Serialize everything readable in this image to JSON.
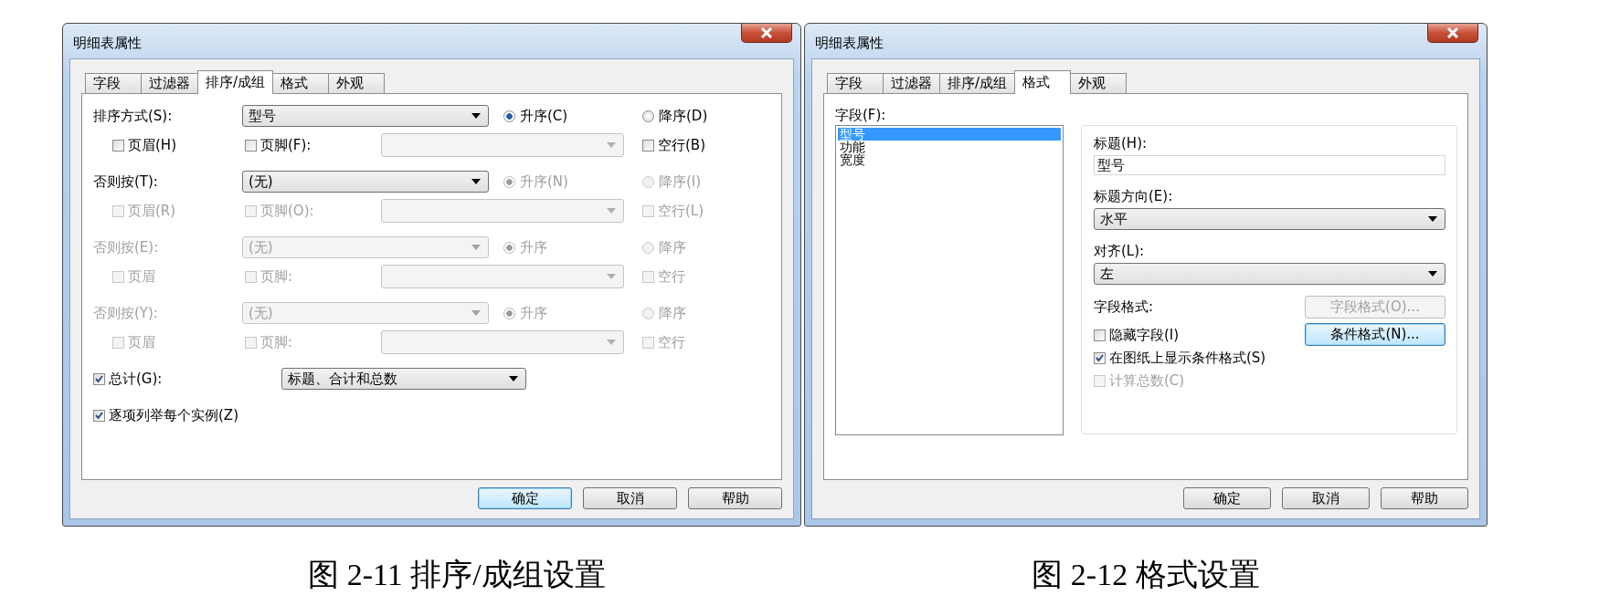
{
  "figures": [
    {
      "dialog": {
        "title": "明细表属性",
        "tabs": [
          {
            "label": "字段",
            "selected": false
          },
          {
            "label": "过滤器",
            "selected": false
          },
          {
            "label": "排序/成组",
            "selected": true
          },
          {
            "label": "格式",
            "selected": false
          },
          {
            "label": "外观",
            "selected": false
          }
        ],
        "kind": "sorting",
        "sort_groups": [
          {
            "label": "排序方式(S):",
            "disabled": false,
            "combo": {
              "value": "型号",
              "disabled": false
            },
            "ascending": {
              "label": "升序(C)",
              "selected": true,
              "disabled": false
            },
            "descending": {
              "label": "降序(D)",
              "selected": false,
              "disabled": false
            },
            "header": {
              "label": "页眉(H)",
              "checked": false,
              "disabled": false
            },
            "footer": {
              "label": "页脚(F):",
              "checked": false,
              "disabled": false
            },
            "footer_combo": {
              "disabled": true
            },
            "blank_line": {
              "label": "空行(B)",
              "checked": false,
              "disabled": false
            }
          },
          {
            "label": "否则按(T):",
            "disabled": false,
            "combo": {
              "value": "(无)",
              "disabled": false
            },
            "ascending": {
              "label": "升序(N)",
              "selected": true,
              "disabled": true
            },
            "descending": {
              "label": "降序(I)",
              "selected": false,
              "disabled": true
            },
            "header": {
              "label": "页眉(R)",
              "checked": false,
              "disabled": true
            },
            "footer": {
              "label": "页脚(O):",
              "checked": false,
              "disabled": true
            },
            "footer_combo": {
              "disabled": true
            },
            "blank_line": {
              "label": "空行(L)",
              "checked": false,
              "disabled": true
            }
          },
          {
            "label": "否则按(E):",
            "disabled": true,
            "combo": {
              "value": "(无)",
              "disabled": true
            },
            "ascending": {
              "label": "升序",
              "selected": true,
              "disabled": true
            },
            "descending": {
              "label": "降序",
              "selected": false,
              "disabled": true
            },
            "header": {
              "label": "页眉",
              "checked": false,
              "disabled": true
            },
            "footer": {
              "label": "页脚:",
              "checked": false,
              "disabled": true
            },
            "footer_combo": {
              "disabled": true
            },
            "blank_line": {
              "label": "空行",
              "checked": false,
              "disabled": true
            }
          },
          {
            "label": "否则按(Y):",
            "disabled": true,
            "combo": {
              "value": "(无)",
              "disabled": true
            },
            "ascending": {
              "label": "升序",
              "selected": true,
              "disabled": true
            },
            "descending": {
              "label": "降序",
              "selected": false,
              "disabled": true
            },
            "header": {
              "label": "页眉",
              "checked": false,
              "disabled": true
            },
            "footer": {
              "label": "页脚:",
              "checked": false,
              "disabled": true
            },
            "footer_combo": {
              "disabled": true
            },
            "blank_line": {
              "label": "空行",
              "checked": false,
              "disabled": true
            }
          }
        ],
        "grand_total": {
          "label": "总计(G):",
          "checked": true,
          "value": "标题、合计和总数"
        },
        "itemize": {
          "label": "逐项列举每个实例(Z)",
          "checked": true
        },
        "buttons": [
          {
            "label": "确定",
            "focused": true
          },
          {
            "label": "取消",
            "focused": false
          },
          {
            "label": "帮助",
            "focused": false
          }
        ]
      },
      "caption": "图 2-11 排序/成组设置"
    },
    {
      "dialog": {
        "title": "明细表属性",
        "tabs": [
          {
            "label": "字段",
            "selected": false
          },
          {
            "label": "过滤器",
            "selected": false
          },
          {
            "label": "排序/成组",
            "selected": false
          },
          {
            "label": "格式",
            "selected": true
          },
          {
            "label": "外观",
            "selected": false
          }
        ],
        "kind": "format",
        "fields_label": "字段(F):",
        "fields": [
          {
            "label": "型号",
            "selected": true
          },
          {
            "label": "功能",
            "selected": false
          },
          {
            "label": "宽度",
            "selected": false
          }
        ],
        "heading_label": "标题(H):",
        "heading_value": "型号",
        "orientation_label": "标题方向(E):",
        "orientation_value": "水平",
        "alignment_label": "对齐(L):",
        "alignment_value": "左",
        "field_format_label": "字段格式:",
        "field_format_button": {
          "label": "字段格式(O)...",
          "disabled": true
        },
        "conditional_button": {
          "label": "条件格式(N)...",
          "disabled": false,
          "focused": true
        },
        "options": [
          {
            "label": "隐藏字段(I)",
            "checked": false,
            "disabled": false
          },
          {
            "label": "在图纸上显示条件格式(S)",
            "checked": true,
            "disabled": false
          },
          {
            "label": "计算总数(C)",
            "checked": false,
            "disabled": true
          }
        ],
        "buttons": [
          {
            "label": "确定",
            "focused": false
          },
          {
            "label": "取消",
            "focused": false
          },
          {
            "label": "帮助",
            "focused": false
          }
        ]
      },
      "caption": "图 2-12 格式设置"
    }
  ]
}
